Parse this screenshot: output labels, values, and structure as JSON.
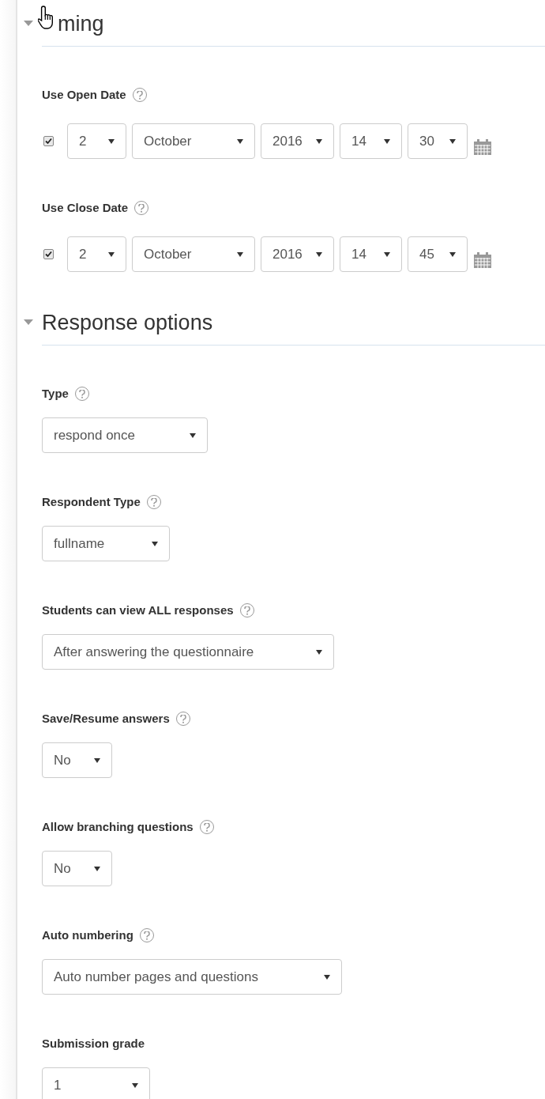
{
  "sections": [
    {
      "title": "ming",
      "title_hidden_start": true,
      "expanded": true,
      "fields": [
        {
          "kind": "date",
          "label": "Use Open Date",
          "help": true,
          "checked": true,
          "parts": [
            "2",
            "October",
            "2016",
            "14",
            "30"
          ]
        },
        {
          "kind": "date",
          "label": "Use Close Date",
          "help": true,
          "checked": true,
          "parts": [
            "2",
            "October",
            "2016",
            "14",
            "45"
          ]
        }
      ]
    },
    {
      "title": "Response options",
      "title_hidden_start": false,
      "expanded": true,
      "fields": [
        {
          "kind": "select",
          "label": "Type",
          "help": true,
          "value": "respond once"
        },
        {
          "kind": "select",
          "label": "Respondent Type",
          "help": true,
          "value": "fullname"
        },
        {
          "kind": "select",
          "label": "Students can view ALL responses",
          "help": true,
          "value": "After answering the questionnaire"
        },
        {
          "kind": "select",
          "label": "Save/Resume answers",
          "help": true,
          "value": "No"
        },
        {
          "kind": "select",
          "label": "Allow branching questions",
          "help": true,
          "value": "No"
        },
        {
          "kind": "select",
          "label": "Auto numbering",
          "help": true,
          "value": "Auto number pages and questions"
        },
        {
          "kind": "select",
          "label": "Submission grade",
          "help": false,
          "value": "1"
        }
      ]
    }
  ]
}
